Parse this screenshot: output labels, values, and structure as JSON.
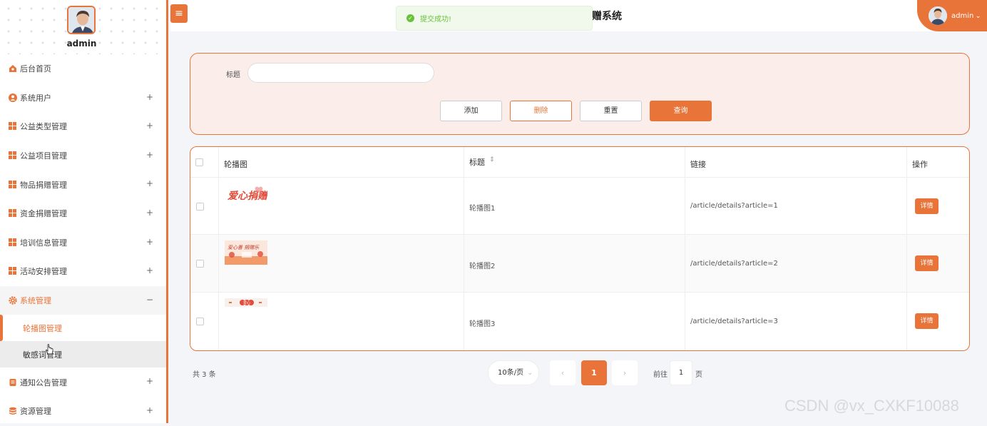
{
  "sidebar": {
    "user_name": "admin",
    "items": [
      {
        "label": "后台首页",
        "icon": "home-icon",
        "expandable": false
      },
      {
        "label": "系统用户",
        "icon": "user-icon",
        "expandable": true
      },
      {
        "label": "公益类型管理",
        "icon": "grid-icon",
        "expandable": true
      },
      {
        "label": "公益项目管理",
        "icon": "grid-icon",
        "expandable": true
      },
      {
        "label": "物品捐赠管理",
        "icon": "grid-icon",
        "expandable": true
      },
      {
        "label": "资金捐赠管理",
        "icon": "grid-icon",
        "expandable": true
      },
      {
        "label": "培训信息管理",
        "icon": "grid-icon",
        "expandable": true
      },
      {
        "label": "活动安排管理",
        "icon": "grid-icon",
        "expandable": true
      },
      {
        "label": "系统管理",
        "icon": "gear-icon",
        "expandable": true,
        "expanded": true
      },
      {
        "label": "通知公告管理",
        "icon": "notice-icon",
        "expandable": true
      },
      {
        "label": "资源管理",
        "icon": "database-icon",
        "expandable": true
      }
    ],
    "expand_symbol": "+",
    "collapse_symbol": "−",
    "submenu": [
      {
        "label": "轮播图管理",
        "active": true
      },
      {
        "label": "敏感词管理",
        "active": false
      }
    ]
  },
  "header": {
    "menu_toggle": "≡",
    "title": "赠系统",
    "user_name": "admin",
    "user_caret": "⌄"
  },
  "toast": {
    "message": "提交成功!",
    "icon": "check-circle-icon"
  },
  "search": {
    "title_label": "标题",
    "title_value": "",
    "buttons": {
      "add": "添加",
      "delete": "删除",
      "reset": "重置",
      "query": "查询"
    }
  },
  "table": {
    "columns": [
      "轮播图",
      "标题",
      "链接",
      "操作"
    ],
    "sort_icon": "⇕",
    "rows": [
      {
        "title": "轮播图1",
        "link": "/article/details?article=1",
        "action": "详情",
        "image_text": "爱心捐赠"
      },
      {
        "title": "轮播图2",
        "link": "/article/details?article=2",
        "action": "详情",
        "image_text": "爱心善 捐赠乐"
      },
      {
        "title": "轮播图3",
        "link": "/article/details?article=3",
        "action": "详情",
        "image_text": "爱心"
      }
    ]
  },
  "pagination": {
    "total": "共 3 条",
    "page_size": "10条/页",
    "prev": "‹",
    "current": "1",
    "next": "›",
    "goto_prefix": "前往",
    "goto_value": "1",
    "goto_suffix": "页"
  },
  "watermark": "CSDN @vx_CXKF10088",
  "colors": {
    "accent": "#e8743a",
    "success": "#67c23a"
  }
}
